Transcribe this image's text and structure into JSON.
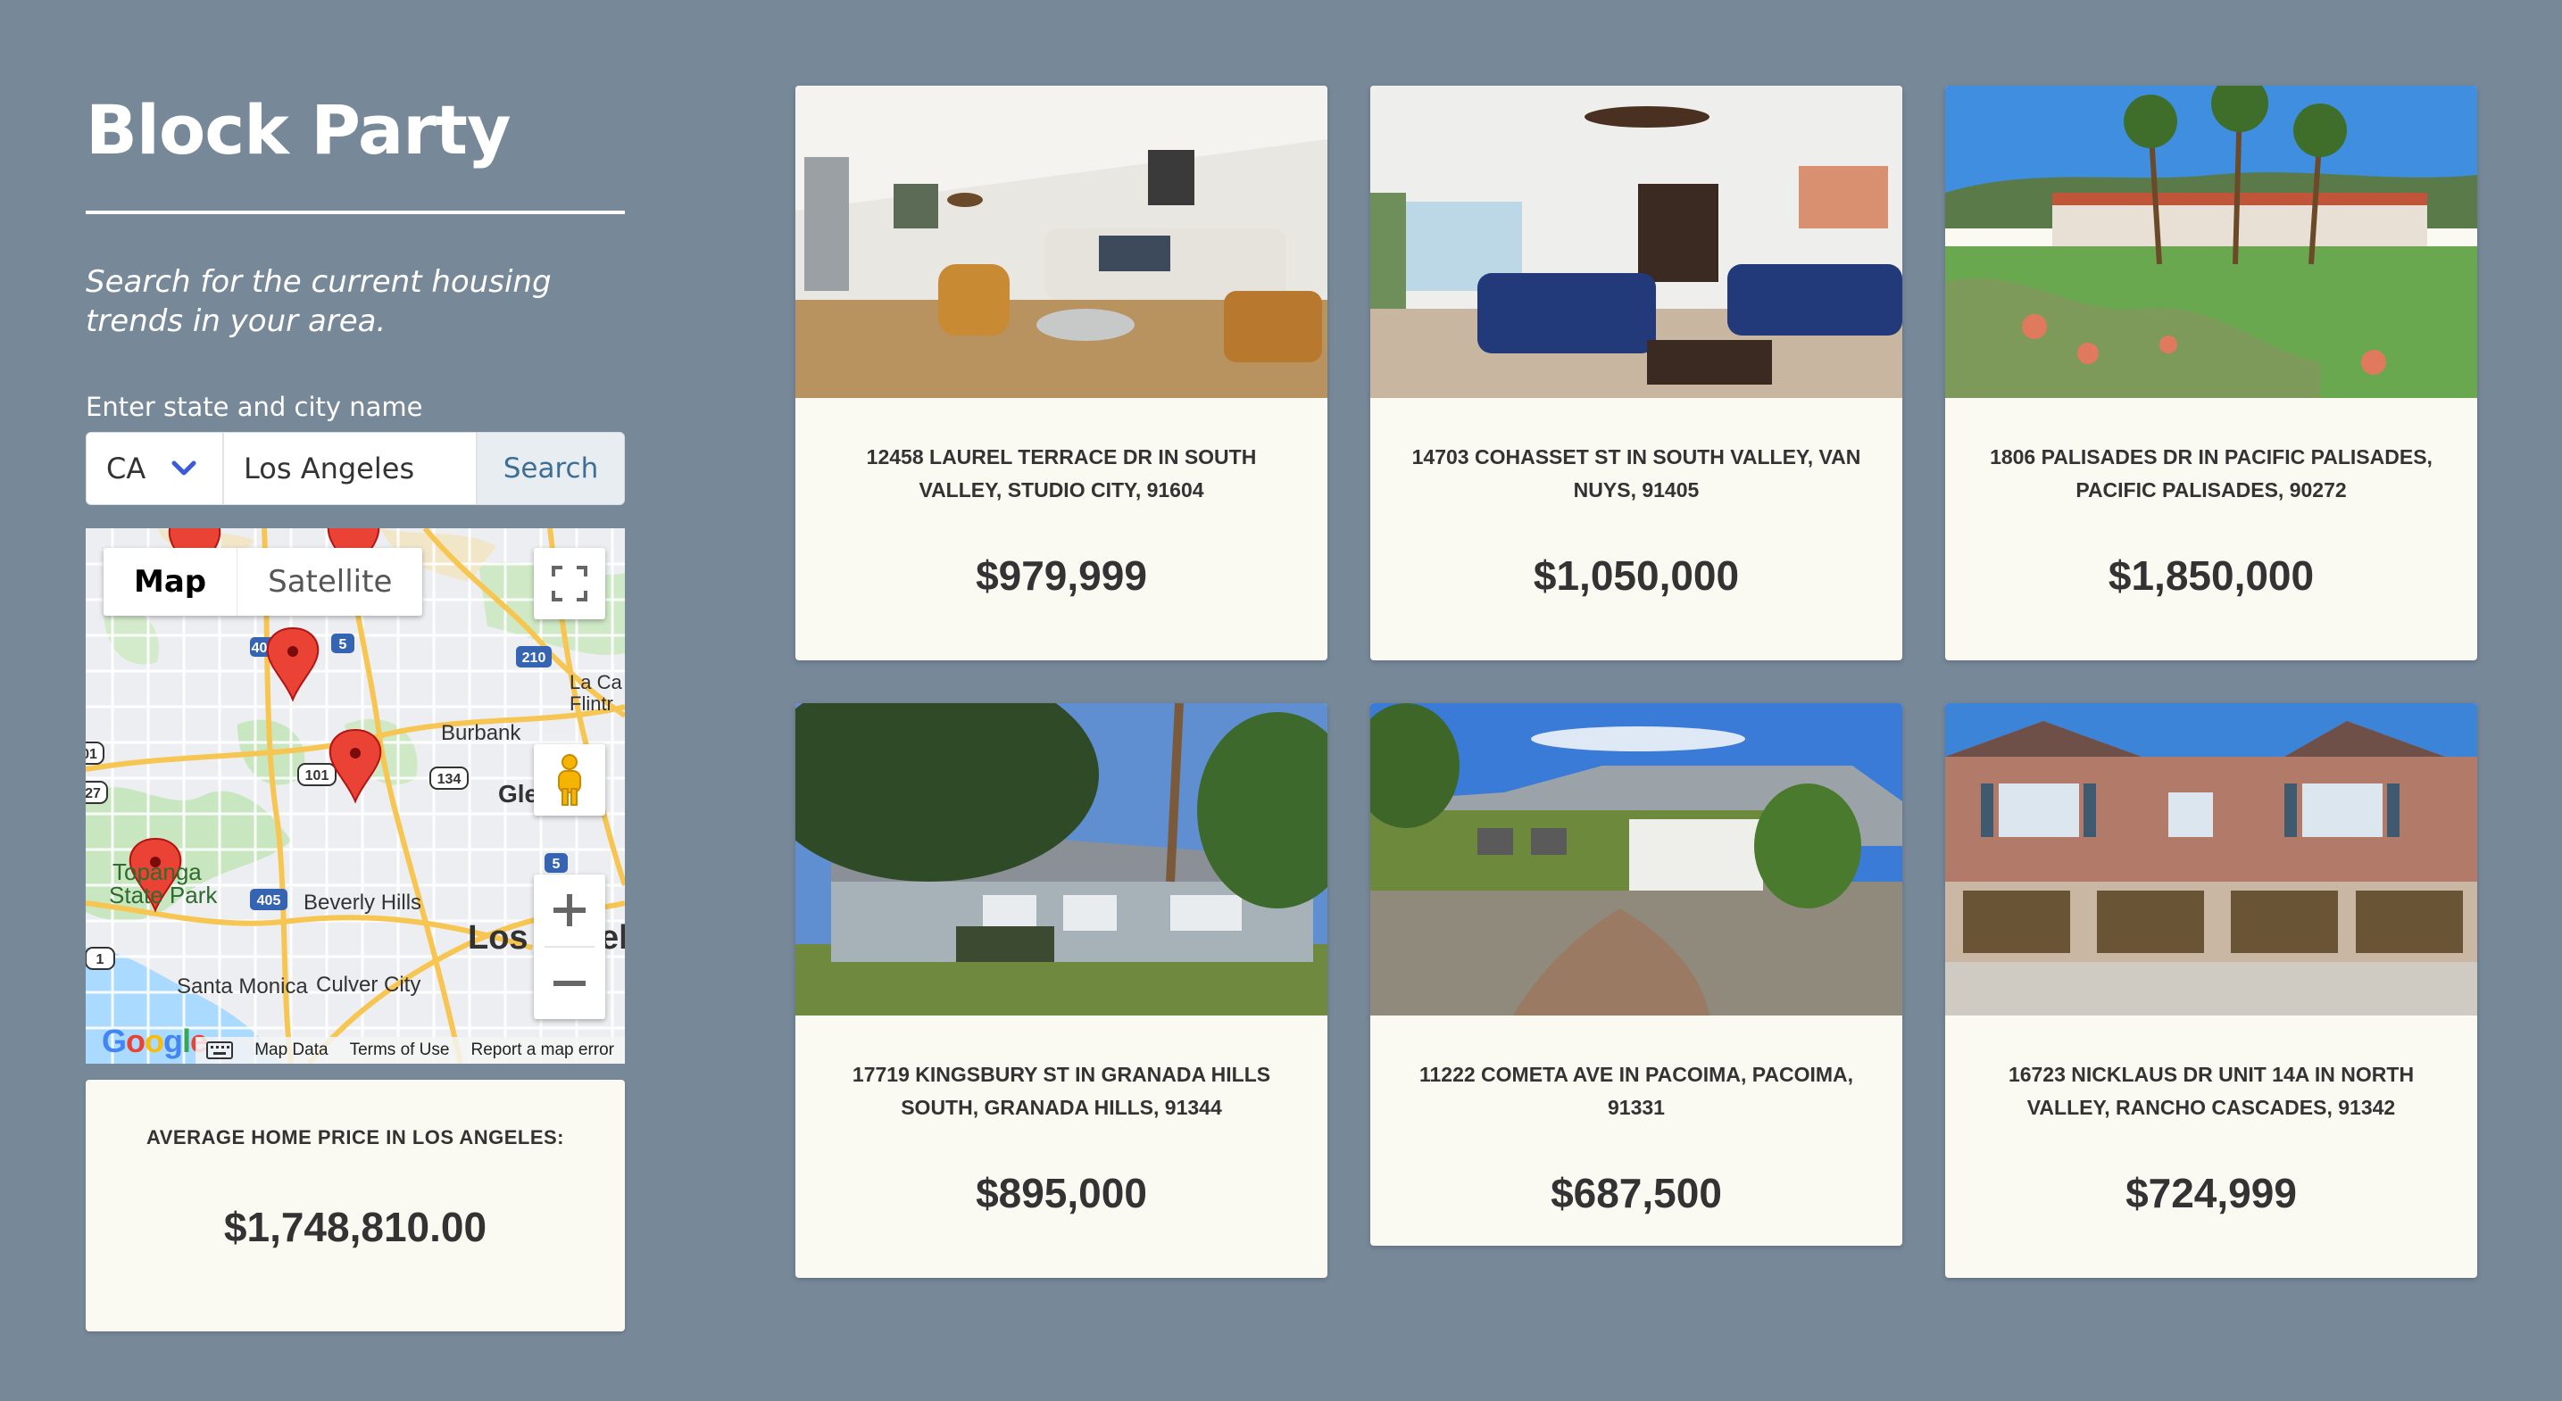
{
  "app": {
    "title": "Block Party",
    "tagline": "Search for the current housing trends in your area."
  },
  "search": {
    "label": "Enter state and city name",
    "state_value": "CA",
    "city_value": "Los Angeles",
    "button_label": "Search"
  },
  "map": {
    "type_options": [
      "Map",
      "Satellite"
    ],
    "selected_type": "Map",
    "places": [
      "La Ca",
      "Flintr",
      "Burbank",
      "Gle",
      "Topanga",
      "State Park",
      "Beverly Hills",
      "Los",
      "el",
      "Santa Monica",
      "Culver City"
    ],
    "highway_shields": [
      "405",
      "5",
      "210",
      "101",
      "134",
      "5",
      "405",
      "1",
      "27",
      "01"
    ],
    "footer": {
      "map_data": "Map Data",
      "terms": "Terms of Use",
      "report": "Report a map error"
    },
    "logo": "Google"
  },
  "average": {
    "label": "AVERAGE HOME PRICE IN LOS ANGELES:",
    "value": "$1,748,810.00"
  },
  "listings": [
    {
      "address": "12458 LAUREL TERRACE DR IN SOUTH VALLEY, STUDIO CITY, 91604",
      "price": "$979,999"
    },
    {
      "address": "14703 COHASSET ST IN SOUTH VALLEY, VAN NUYS, 91405",
      "price": "$1,050,000"
    },
    {
      "address": "1806 PALISADES DR IN PACIFIC PALISADES, PACIFIC PALISADES, 90272",
      "price": "$1,850,000"
    },
    {
      "address": "17719 KINGSBURY ST IN GRANADA HILLS SOUTH, GRANADA HILLS, 91344",
      "price": "$895,000"
    },
    {
      "address": "11222 COMETA AVE IN PACOIMA, PACOIMA, 91331",
      "price": "$687,500"
    },
    {
      "address": "16723 NICKLAUS DR UNIT 14A IN NORTH VALLEY, RANCHO CASCADES, 91342",
      "price": "$724,999"
    }
  ],
  "colors": {
    "background": "#778899",
    "card": "#faf9f2",
    "pin": "#ea4335",
    "search_button_text": "#3d6e96"
  }
}
